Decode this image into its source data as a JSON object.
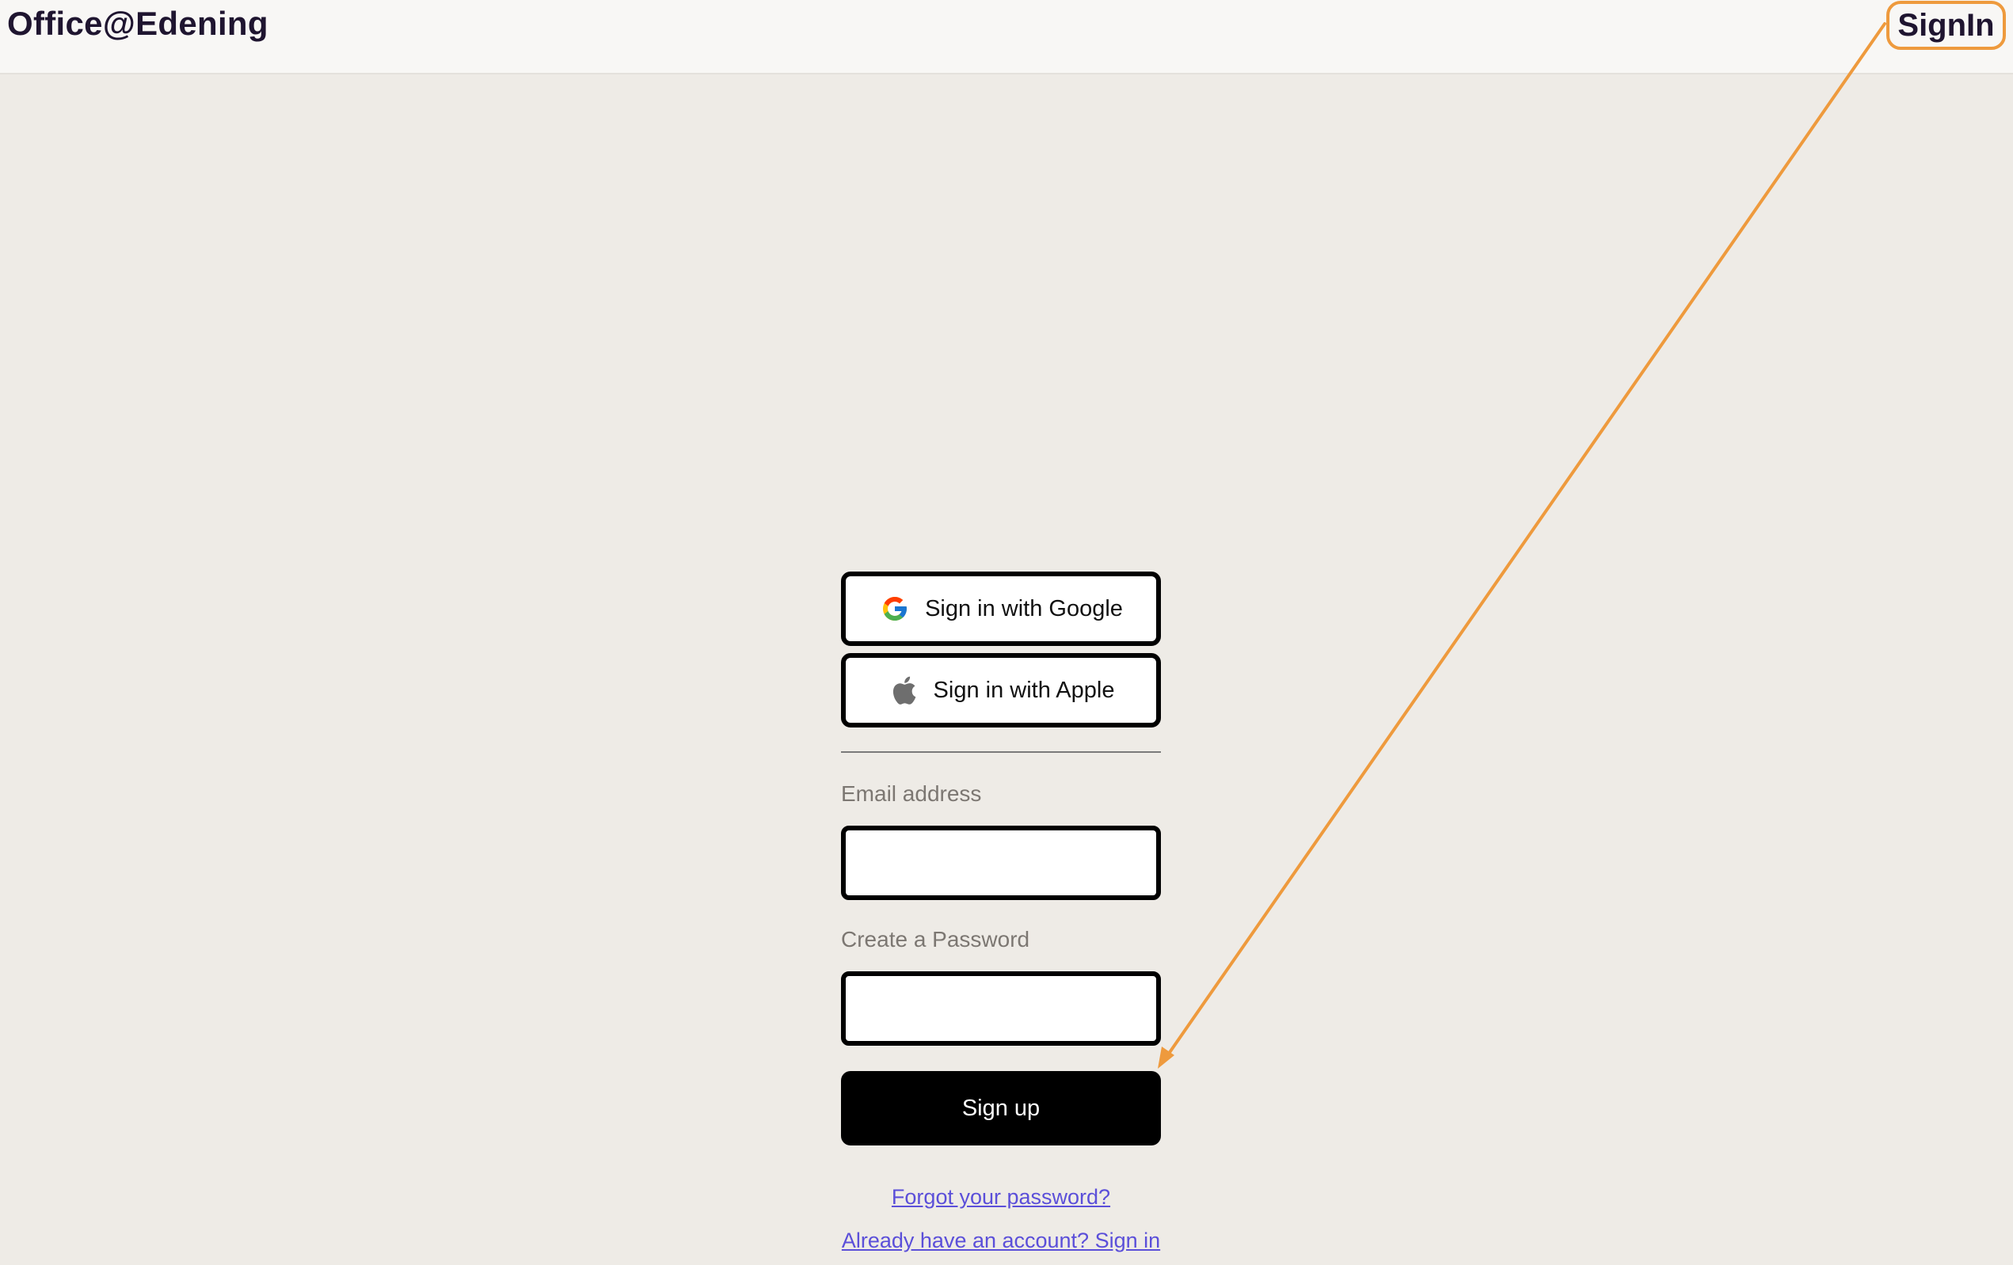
{
  "header": {
    "brand": "Office@Edening",
    "signin_label": "SignIn"
  },
  "form": {
    "google_label": "Sign in with Google",
    "apple_label": "Sign in with Apple",
    "email_label": "Email address",
    "email_value": "",
    "password_label": "Create a Password",
    "password_value": "",
    "submit_label": "Sign up",
    "forgot_link": "Forgot your password?",
    "signin_link": "Already have an account? Sign in"
  },
  "icons": {
    "google": "google-icon",
    "apple": "apple-icon"
  },
  "colors": {
    "page_bg": "#eeebe6",
    "header_bg": "#f8f7f5",
    "highlight": "#ee9a3d",
    "link": "#5b4fd9",
    "primary_button": "#000000"
  }
}
